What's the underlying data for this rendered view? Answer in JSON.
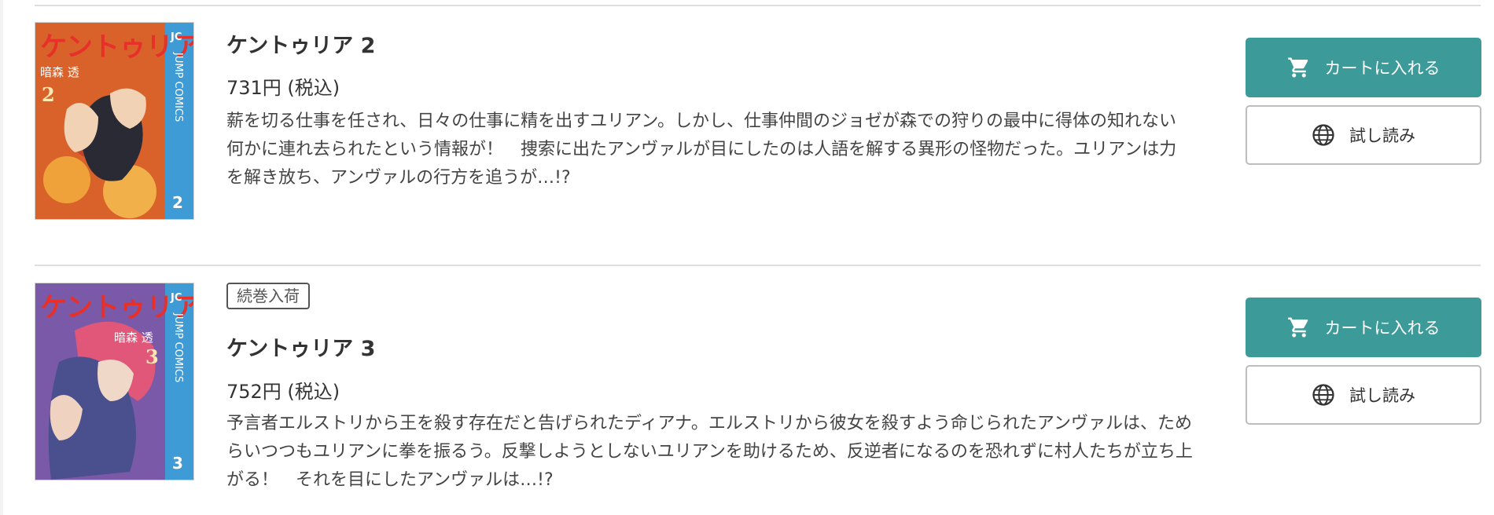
{
  "items": [
    {
      "badge": "",
      "title": "ケントゥリア 2",
      "price": "731円 (税込)",
      "description": "薪を切る仕事を任され、日々の仕事に精を出すユリアン。しかし、仕事仲間のジョゼが森での狩りの最中に得体の知れない何かに連れ去られたという情報が！　捜索に出たアンヴァルが目にしたのは人語を解する異形の怪物だった。ユリアンは力を解き放ち、アンヴァルの行方を追うが…!?",
      "cover": {
        "logo": "ケントゥリア",
        "author": "暗森 透",
        "volume": "2",
        "series_label": "JUMP COMICS",
        "publisher_mark": "JC",
        "colors": {
          "art": "#d9612a",
          "accent": "#f0a23a",
          "spine": "#3e9bd6",
          "logo": "#e8302a"
        }
      },
      "buttons": {
        "cart": "カートに入れる",
        "trial": "試し読み"
      }
    },
    {
      "badge": "続巻入荷",
      "title": "ケントゥリア 3",
      "price": "752円 (税込)",
      "description": "予言者エルストリから王を殺す存在だと告げられたディアナ。エルストリから彼女を殺すよう命じられたアンヴァルは、ためらいつつもユリアンに拳を振るう。反撃しようとしないユリアンを助けるため、反逆者になるのを恐れずに村人たちが立ち上がる！　それを目にしたアンヴァルは…!?",
      "cover": {
        "logo": "ケントゥリア",
        "author": "暗森 透",
        "volume": "3",
        "series_label": "JUMP COMICS",
        "publisher_mark": "JC",
        "colors": {
          "art": "#7a5aa8",
          "accent": "#e0577a",
          "spine": "#3e9bd6",
          "logo": "#e8302a"
        }
      },
      "buttons": {
        "cart": "カートに入れる",
        "trial": "試し読み"
      }
    }
  ],
  "icons": {
    "cart": "cart-icon",
    "trial": "globe-icon"
  },
  "theme": {
    "cart_button": "#3c9a98",
    "divider": "#dedede"
  }
}
